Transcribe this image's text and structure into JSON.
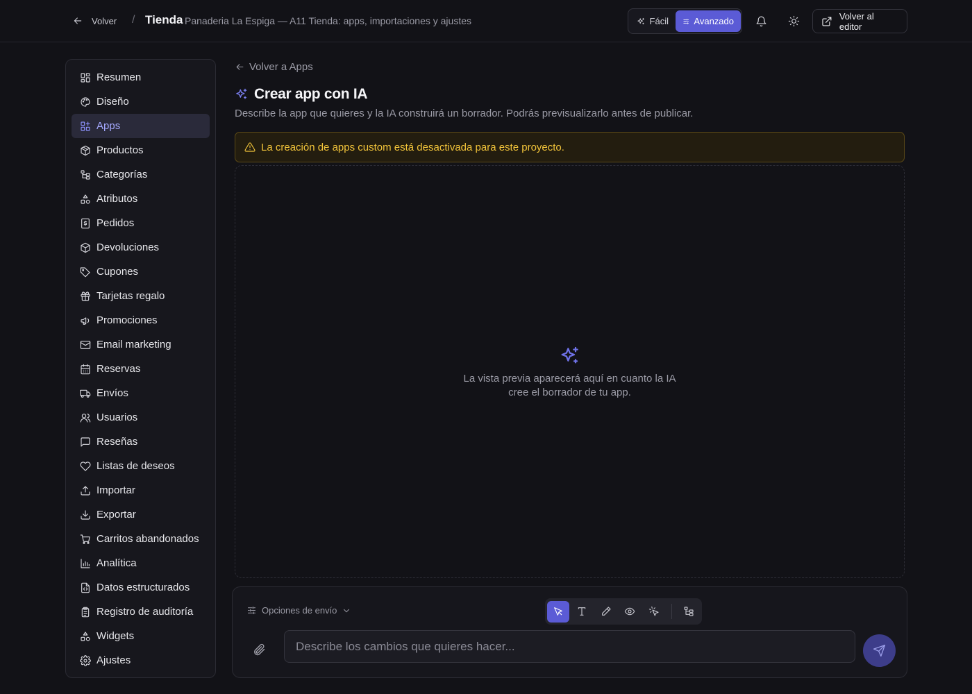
{
  "topbar": {
    "back_label": "Volver",
    "separator": "/",
    "section_title": "Tienda",
    "subtitle": "Panaderia La Espiga — A11 Tienda: apps, importaciones y ajustes",
    "mode_easy": "Fácil",
    "mode_advanced": "Avanzado",
    "active_mode": "Avanzado",
    "editor_button": "Volver al editor",
    "icons": [
      "bell-icon",
      "sun-icon",
      "external-link-icon"
    ]
  },
  "sidebar": {
    "active": "Apps",
    "items": [
      {
        "label": "Resumen",
        "icon": "dashboard-icon"
      },
      {
        "label": "Diseño",
        "icon": "palette-icon"
      },
      {
        "label": "Apps",
        "icon": "apps-icon"
      },
      {
        "label": "Productos",
        "icon": "package-icon"
      },
      {
        "label": "Categorías",
        "icon": "category-tree-icon"
      },
      {
        "label": "Atributos",
        "icon": "shapes-icon"
      },
      {
        "label": "Pedidos",
        "icon": "receipt-icon"
      },
      {
        "label": "Devoluciones",
        "icon": "package-return-icon"
      },
      {
        "label": "Cupones",
        "icon": "tag-icon"
      },
      {
        "label": "Tarjetas regalo",
        "icon": "gift-icon"
      },
      {
        "label": "Promociones",
        "icon": "megaphone-icon"
      },
      {
        "label": "Email marketing",
        "icon": "mail-icon"
      },
      {
        "label": "Reservas",
        "icon": "calendar-icon"
      },
      {
        "label": "Envíos",
        "icon": "truck-icon"
      },
      {
        "label": "Usuarios",
        "icon": "users-icon"
      },
      {
        "label": "Reseñas",
        "icon": "message-square-icon"
      },
      {
        "label": "Listas de deseos",
        "icon": "heart-icon"
      },
      {
        "label": "Importar",
        "icon": "upload-icon"
      },
      {
        "label": "Exportar",
        "icon": "download-icon"
      },
      {
        "label": "Carritos abandonados",
        "icon": "cart-icon"
      },
      {
        "label": "Analítica",
        "icon": "bar-chart-icon"
      },
      {
        "label": "Datos estructurados",
        "icon": "file-code-icon"
      },
      {
        "label": "Registro de auditoría",
        "icon": "clipboard-list-icon"
      },
      {
        "label": "Widgets",
        "icon": "shapes-icon"
      },
      {
        "label": "Ajustes",
        "icon": "gear-icon"
      }
    ]
  },
  "main": {
    "back_label": "Volver a Apps",
    "title": "Crear app con IA",
    "description": "Describe la app que quieres y la IA construirá un borrador. Podrás previsualizarlo antes de publicar.",
    "alert": "La creación de apps custom está desactivada para este proyecto.",
    "preview_text_line1": "La vista previa aparecerá aquí en cuanto la IA",
    "preview_text_line2": "cree el borrador de tu app."
  },
  "composer": {
    "send_options": "Opciones de envío",
    "tools": [
      "pointer-icon",
      "text-icon",
      "pencil-icon",
      "eye-icon",
      "sparkle-click-icon",
      "tree-icon"
    ],
    "active_tool": "pointer-icon",
    "placeholder": "Describe los cambios que quieres hacer..."
  },
  "colors": {
    "accent": "#5b5bd6",
    "background": "#121217",
    "alert_text": "#f2c43a"
  }
}
